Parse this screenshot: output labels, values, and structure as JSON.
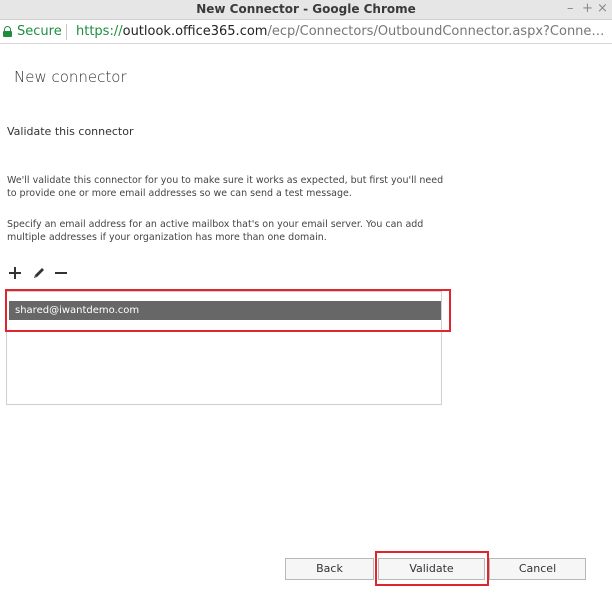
{
  "window": {
    "title": "New Connector - Google Chrome",
    "controls": [
      "–",
      "+",
      "×"
    ]
  },
  "addressbar": {
    "secure_label": "Secure",
    "url_scheme": "https://",
    "url_host": "outlook.office365.com",
    "url_path": "/ecp/Connectors/OutboundConnector.aspx?ConnectorTyp..."
  },
  "page": {
    "title": "New connector",
    "section_heading": "Validate this connector",
    "paragraph1": "We'll validate this connector for you to make sure it works as expected, but first you'll need to provide one or more email addresses so we can send a test message.",
    "paragraph2": "Specify an email address for an active mailbox that's on your email server. You can add multiple addresses if your organization has more than one domain."
  },
  "toolbar": {
    "icons": [
      "add-icon",
      "edit-icon",
      "remove-icon"
    ]
  },
  "email_list": {
    "items": [
      {
        "address": "shared@iwantdemo.com",
        "selected": true
      }
    ]
  },
  "buttons": {
    "back": "Back",
    "validate": "Validate",
    "cancel": "Cancel"
  },
  "colors": {
    "secure_green": "#1e8e3e",
    "highlight_red": "#e0262c",
    "selected_row": "#676767"
  }
}
